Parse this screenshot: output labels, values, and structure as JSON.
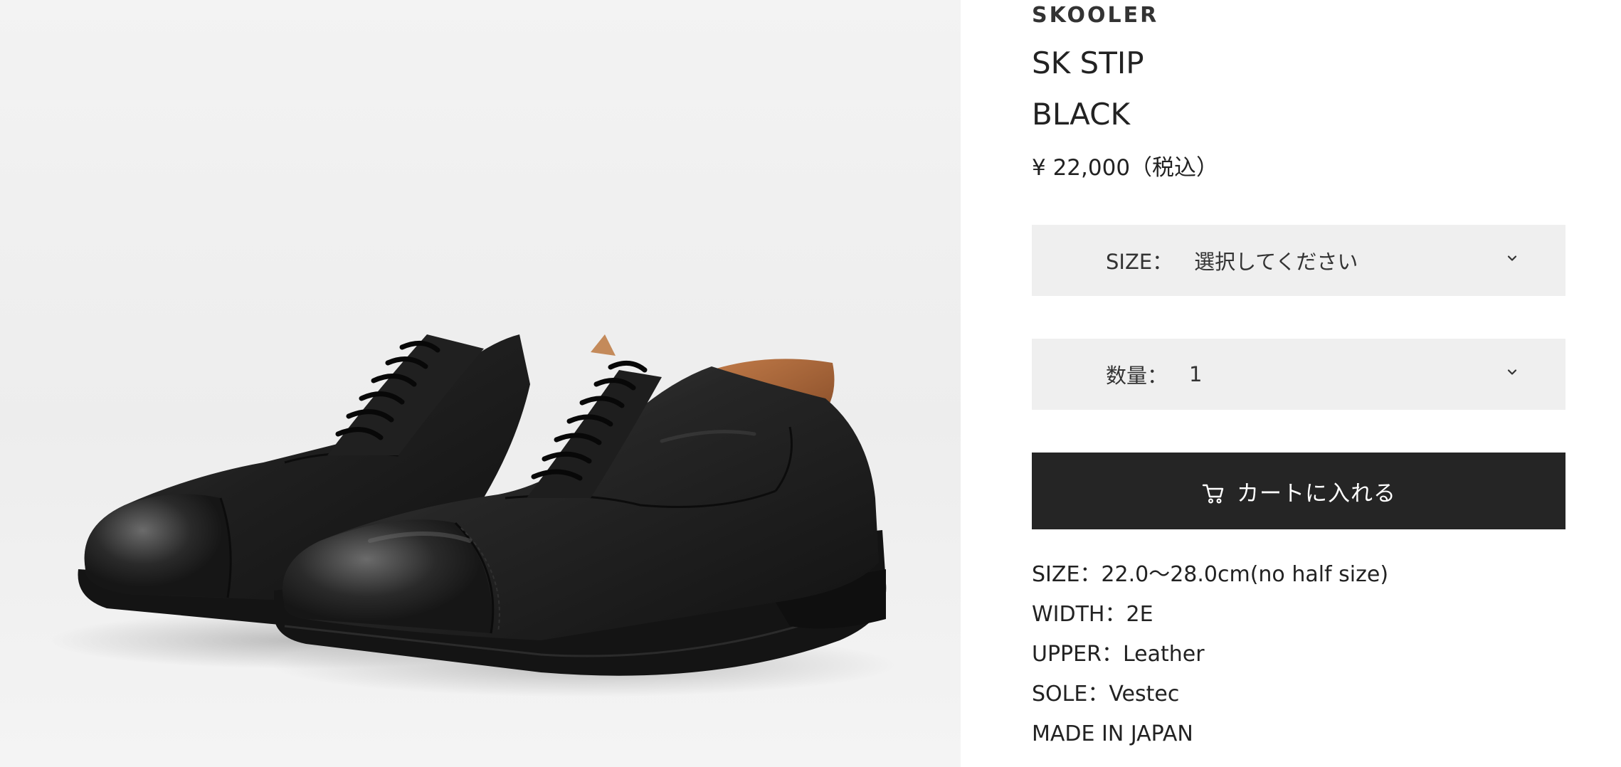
{
  "product": {
    "brand": "SKOOLER",
    "name": "SK STIP",
    "color": "BLACK",
    "price": "¥ 22,000（税込）"
  },
  "options": {
    "size_label": "SIZE：",
    "size_value": "選択してください",
    "qty_label": "数量：",
    "qty_value": "1"
  },
  "cart": {
    "label": "カートに入れる",
    "icon": "cart-icon"
  },
  "specs": {
    "size": "SIZE：22.0〜28.0cm(no half size)",
    "width": "WIDTH：2E",
    "upper": "UPPER：Leather",
    "sole": "SOLE：Vestec",
    "origin": "MADE IN JAPAN"
  },
  "colors": {
    "button_bg": "#252525",
    "select_bg": "#efefef",
    "text": "#222222"
  }
}
